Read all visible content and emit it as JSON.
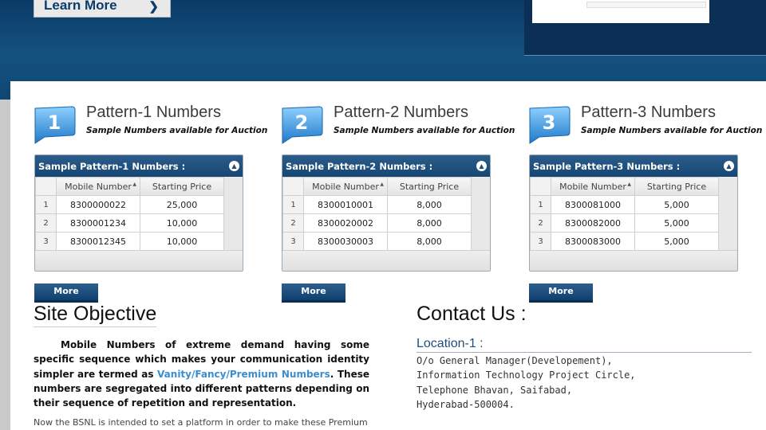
{
  "banner": {
    "learn_more_label": "Learn More"
  },
  "patterns": [
    {
      "number": "1",
      "title": "Pattern-1 Numbers",
      "subtitle": "Sample Numbers available for Auction",
      "grid_title": "Sample Pattern-1 Numbers :",
      "col_mobile": "Mobile Number",
      "col_price": "Starting Price",
      "rows": [
        {
          "n": "1",
          "mobile": "8300000022",
          "price": "25,000"
        },
        {
          "n": "2",
          "mobile": "8300001234",
          "price": "10,000"
        },
        {
          "n": "3",
          "mobile": "8300012345",
          "price": "10,000"
        }
      ],
      "more_label": "More"
    },
    {
      "number": "2",
      "title": "Pattern-2 Numbers",
      "subtitle": "Sample Numbers available for Auction",
      "grid_title": "Sample Pattern-2 Numbers :",
      "col_mobile": "Mobile Number",
      "col_price": "Starting Price",
      "rows": [
        {
          "n": "1",
          "mobile": "8300010001",
          "price": "8,000"
        },
        {
          "n": "2",
          "mobile": "8300020002",
          "price": "8,000"
        },
        {
          "n": "3",
          "mobile": "8300030003",
          "price": "8,000"
        }
      ],
      "more_label": "More"
    },
    {
      "number": "3",
      "title": "Pattern-3 Numbers",
      "subtitle": "Sample Numbers available for Auction",
      "grid_title": "Sample Pattern-3 Numbers :",
      "col_mobile": "Mobile Number",
      "col_price": "Starting Price",
      "rows": [
        {
          "n": "1",
          "mobile": "8300081000",
          "price": "5,000"
        },
        {
          "n": "2",
          "mobile": "8300082000",
          "price": "5,000"
        },
        {
          "n": "3",
          "mobile": "8300083000",
          "price": "5,000"
        }
      ],
      "more_label": "More"
    }
  ],
  "site_objective": {
    "title": "Site Objective",
    "text_before": "Mobile Numbers of extreme demand having some specific sequence which makes your communication identity simpler are termed as ",
    "highlight": "Vanity/Fancy/Premium Numbers",
    "text_after": ". These numbers are segregated into different patterns depending on their sequence of repetition and representation.",
    "more_text": "Now the BSNL is intended to set a platform in order to make these Premium"
  },
  "contact": {
    "title": "Contact Us :",
    "location_title": "Location-1 :",
    "address_lines": [
      "O/o General Manager(Developement),",
      "Information Technology Project Circle,",
      "Telephone Bhavan, Saifabad,",
      "Hyderabad-500004."
    ]
  },
  "colors": {
    "banner_blue": "#14527f",
    "grid_header": "#1d4e7d",
    "link_highlight": "#3a8ed0"
  },
  "icons": {
    "collapse": "chevron-up-icon",
    "sort": "sort-asc-icon",
    "badge": "number-ribbon-icon"
  }
}
